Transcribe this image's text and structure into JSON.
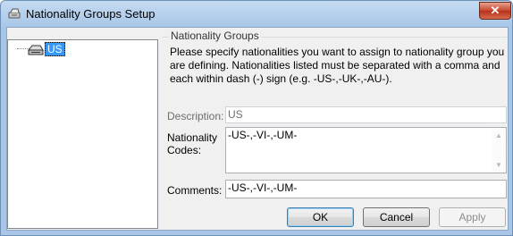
{
  "window": {
    "title": "Nationality Groups Setup",
    "close_glyph": "✕"
  },
  "tree": {
    "items": [
      {
        "label": "US",
        "icon": "group-icon"
      }
    ]
  },
  "group": {
    "legend": "Nationality Groups",
    "instructions": "Please specify nationalities you want to assign to nationality group you are defining. Nationalities listed must be separated with a comma and each within dash (-) sign (e.g. -US-,-UK-,-AU-)."
  },
  "form": {
    "description_label": "Description:",
    "description_value": "US",
    "codes_label": "Nationality Codes:",
    "codes_value": "-US-,-VI-,-UM-",
    "comments_label": "Comments:",
    "comments_value": "-US-,-VI-,-UM-"
  },
  "buttons": {
    "ok": "OK",
    "cancel": "Cancel",
    "apply": "Apply"
  },
  "colors": {
    "selection": "#3399ff",
    "close_button": "#c9452c",
    "title_bar": "#c4daf1"
  }
}
